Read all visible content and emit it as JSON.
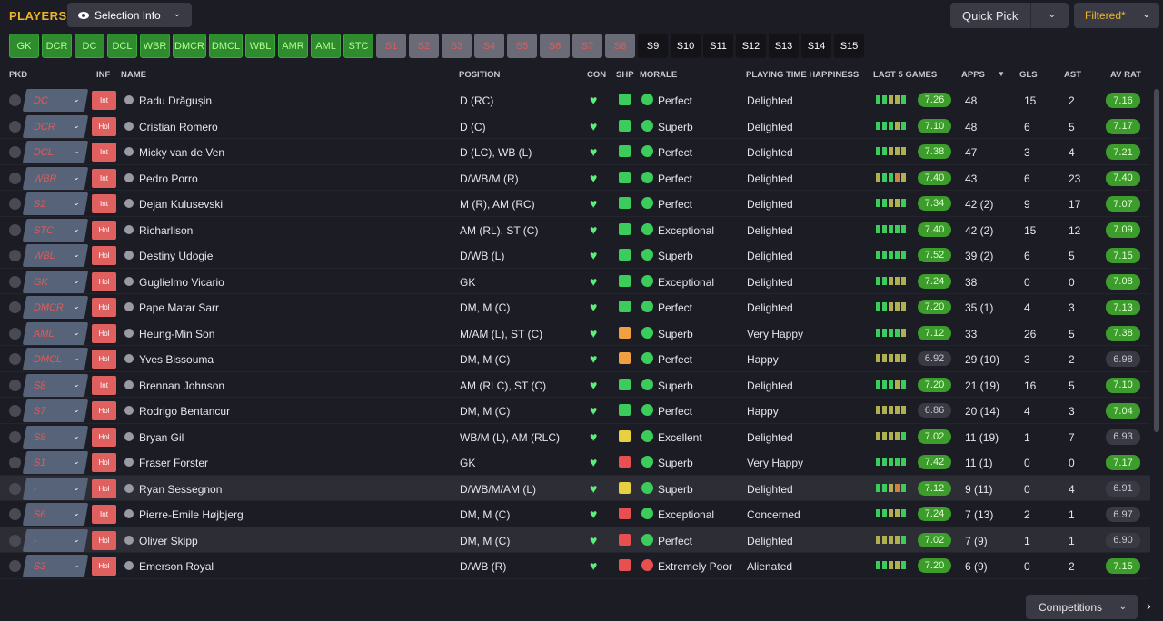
{
  "header": {
    "title": "PLAYERS",
    "selection_info": "Selection Info",
    "quick_pick": "Quick Pick",
    "filtered": "Filtered*"
  },
  "positions": [
    {
      "label": "GK",
      "state": "green"
    },
    {
      "label": "DCR",
      "state": "green"
    },
    {
      "label": "DC",
      "state": "green"
    },
    {
      "label": "DCL",
      "state": "green"
    },
    {
      "label": "WBR",
      "state": "green"
    },
    {
      "label": "DMCR",
      "state": "green"
    },
    {
      "label": "DMCL",
      "state": "green"
    },
    {
      "label": "WBL",
      "state": "green"
    },
    {
      "label": "AMR",
      "state": "green"
    },
    {
      "label": "AML",
      "state": "green"
    },
    {
      "label": "STC",
      "state": "green"
    },
    {
      "label": "S1",
      "state": "grey"
    },
    {
      "label": "S2",
      "state": "grey"
    },
    {
      "label": "S3",
      "state": "grey"
    },
    {
      "label": "S4",
      "state": "grey"
    },
    {
      "label": "S5",
      "state": "grey"
    },
    {
      "label": "S6",
      "state": "grey"
    },
    {
      "label": "S7",
      "state": "grey"
    },
    {
      "label": "S8",
      "state": "grey"
    },
    {
      "label": "S9",
      "state": "dark"
    },
    {
      "label": "S10",
      "state": "dark"
    },
    {
      "label": "S11",
      "state": "dark"
    },
    {
      "label": "S12",
      "state": "dark"
    },
    {
      "label": "S13",
      "state": "dark"
    },
    {
      "label": "S14",
      "state": "dark"
    },
    {
      "label": "S15",
      "state": "dark"
    }
  ],
  "columns": {
    "pkd": "PKD",
    "inf": "INF",
    "name": "NAME",
    "position": "POSITION",
    "con": "CON",
    "shp": "SHP",
    "morale": "MORALE",
    "pth": "PLAYING TIME HAPPINESS",
    "last5": "LAST 5 GAMES",
    "apps": "APPS",
    "gls": "GLS",
    "ast": "AST",
    "avrat": "AV RAT"
  },
  "players": [
    {
      "pkd": "DC",
      "inf": "Int",
      "name": "Radu Drăgușin",
      "position": "D (RC)",
      "shp": "green",
      "morale": "Perfect",
      "pth": "Delighted",
      "l5": "ggyyg",
      "rat": "7.26",
      "ratg": false,
      "apps": "48",
      "gls": "15",
      "ast": "2",
      "av": "7.16",
      "avg": false
    },
    {
      "pkd": "DCR",
      "inf": "Hol",
      "name": "Cristian Romero",
      "position": "D (C)",
      "shp": "green",
      "morale": "Superb",
      "pth": "Delighted",
      "l5": "gggyg",
      "rat": "7.10",
      "ratg": false,
      "apps": "48",
      "gls": "6",
      "ast": "5",
      "av": "7.17",
      "avg": false
    },
    {
      "pkd": "DCL",
      "inf": "Int",
      "name": "Micky van de Ven",
      "position": "D (LC), WB (L)",
      "shp": "green",
      "morale": "Perfect",
      "pth": "Delighted",
      "l5": "ggyyy",
      "rat": "7.38",
      "ratg": false,
      "apps": "47",
      "gls": "3",
      "ast": "4",
      "av": "7.21",
      "avg": false
    },
    {
      "pkd": "WBR",
      "inf": "Int",
      "name": "Pedro Porro",
      "position": "D/WB/M (R)",
      "shp": "green",
      "morale": "Perfect",
      "pth": "Delighted",
      "l5": "yggoy",
      "rat": "7.40",
      "ratg": false,
      "apps": "43",
      "gls": "6",
      "ast": "23",
      "av": "7.40",
      "avg": false
    },
    {
      "pkd": "S2",
      "inf": "Int",
      "name": "Dejan Kulusevski",
      "position": "M (R), AM (RC)",
      "shp": "green",
      "morale": "Perfect",
      "pth": "Delighted",
      "l5": "ggyyg",
      "rat": "7.34",
      "ratg": false,
      "apps": "42 (2)",
      "gls": "9",
      "ast": "17",
      "av": "7.07",
      "avg": false
    },
    {
      "pkd": "STC",
      "inf": "Hol",
      "name": "Richarlison",
      "position": "AM (RL), ST (C)",
      "shp": "green",
      "morale": "Exceptional",
      "pth": "Delighted",
      "l5": "ggggg",
      "rat": "7.40",
      "ratg": false,
      "apps": "42 (2)",
      "gls": "15",
      "ast": "12",
      "av": "7.09",
      "avg": false
    },
    {
      "pkd": "WBL",
      "inf": "Hol",
      "name": "Destiny Udogie",
      "position": "D/WB (L)",
      "shp": "green",
      "morale": "Superb",
      "pth": "Delighted",
      "l5": "ggggg",
      "rat": "7.52",
      "ratg": false,
      "apps": "39 (2)",
      "gls": "6",
      "ast": "5",
      "av": "7.15",
      "avg": false
    },
    {
      "pkd": "GK",
      "inf": "Hol",
      "name": "Guglielmo Vicario",
      "position": "GK",
      "shp": "green",
      "morale": "Exceptional",
      "pth": "Delighted",
      "l5": "ggyyy",
      "rat": "7.24",
      "ratg": false,
      "apps": "38",
      "gls": "0",
      "ast": "0",
      "av": "7.08",
      "avg": false
    },
    {
      "pkd": "DMCR",
      "inf": "Hol",
      "name": "Pape Matar Sarr",
      "position": "DM, M (C)",
      "shp": "green",
      "morale": "Perfect",
      "pth": "Delighted",
      "l5": "ggyyy",
      "rat": "7.20",
      "ratg": false,
      "apps": "35 (1)",
      "gls": "4",
      "ast": "3",
      "av": "7.13",
      "avg": false
    },
    {
      "pkd": "AML",
      "inf": "Hol",
      "name": "Heung-Min Son",
      "position": "M/AM (L), ST (C)",
      "shp": "amber",
      "morale": "Superb",
      "pth": "Very Happy",
      "l5": "ggggy",
      "rat": "7.12",
      "ratg": false,
      "apps": "33",
      "gls": "26",
      "ast": "5",
      "av": "7.38",
      "avg": false
    },
    {
      "pkd": "DMCL",
      "inf": "Hol",
      "name": "Yves Bissouma",
      "position": "DM, M (C)",
      "shp": "amber",
      "morale": "Perfect",
      "pth": "Happy",
      "l5": "yyyyy",
      "rat": "6.92",
      "ratg": true,
      "apps": "29 (10)",
      "gls": "3",
      "ast": "2",
      "av": "6.98",
      "avg": true
    },
    {
      "pkd": "S8",
      "inf": "Int",
      "name": "Brennan Johnson",
      "position": "AM (RLC), ST (C)",
      "shp": "green",
      "morale": "Superb",
      "pth": "Delighted",
      "l5": "gggyg",
      "rat": "7.20",
      "ratg": false,
      "apps": "21 (19)",
      "gls": "16",
      "ast": "5",
      "av": "7.10",
      "avg": false
    },
    {
      "pkd": "S7",
      "inf": "Hol",
      "name": "Rodrigo Bentancur",
      "position": "DM, M (C)",
      "shp": "green",
      "morale": "Perfect",
      "pth": "Happy",
      "l5": "yyyyy",
      "rat": "6.86",
      "ratg": true,
      "apps": "20 (14)",
      "gls": "4",
      "ast": "3",
      "av": "7.04",
      "avg": false
    },
    {
      "pkd": "S8",
      "inf": "Hol",
      "name": "Bryan Gil",
      "position": "WB/M (L), AM (RLC)",
      "shp": "yellow",
      "morale": "Excellent",
      "pth": "Delighted",
      "l5": "yyyyg",
      "rat": "7.02",
      "ratg": false,
      "apps": "11 (19)",
      "gls": "1",
      "ast": "7",
      "av": "6.93",
      "avg": true
    },
    {
      "pkd": "S1",
      "inf": "Hol",
      "name": "Fraser Forster",
      "position": "GK",
      "shp": "red",
      "morale": "Superb",
      "pth": "Very Happy",
      "l5": "ggggg",
      "rat": "7.42",
      "ratg": false,
      "apps": "11 (1)",
      "gls": "0",
      "ast": "0",
      "av": "7.17",
      "avg": false
    },
    {
      "pkd": "-",
      "inf": "Hol",
      "name": "Ryan Sessegnon",
      "position": "D/WB/M/AM (L)",
      "shp": "yellow",
      "morale": "Superb",
      "pth": "Delighted",
      "l5": "ggyog",
      "rat": "7.12",
      "ratg": false,
      "apps": "9 (11)",
      "gls": "0",
      "ast": "4",
      "av": "6.91",
      "avg": true
    },
    {
      "pkd": "S6",
      "inf": "Int",
      "name": "Pierre-Emile Højbjerg",
      "position": "DM, M (C)",
      "shp": "red",
      "morale": "Exceptional",
      "pth": "Concerned",
      "l5": "ggyyg",
      "rat": "7.24",
      "ratg": false,
      "apps": "7 (13)",
      "gls": "2",
      "ast": "1",
      "av": "6.97",
      "avg": true
    },
    {
      "pkd": "-",
      "inf": "Hol",
      "name": "Oliver Skipp",
      "position": "DM, M (C)",
      "shp": "red",
      "morale": "Perfect",
      "pth": "Delighted",
      "l5": "yyyyg",
      "rat": "7.02",
      "ratg": false,
      "apps": "7 (9)",
      "gls": "1",
      "ast": "1",
      "av": "6.90",
      "avg": true
    },
    {
      "pkd": "S3",
      "inf": "Hol",
      "name": "Emerson Royal",
      "position": "D/WB (R)",
      "shp": "red",
      "morale": "Extremely Poor",
      "pth": "Alienated",
      "l5": "ggyyg",
      "rat": "7.20",
      "ratg": false,
      "apps": "6 (9)",
      "gls": "0",
      "ast": "2",
      "av": "7.15",
      "avg": false
    }
  ],
  "footer": {
    "competitions": "Competitions"
  }
}
